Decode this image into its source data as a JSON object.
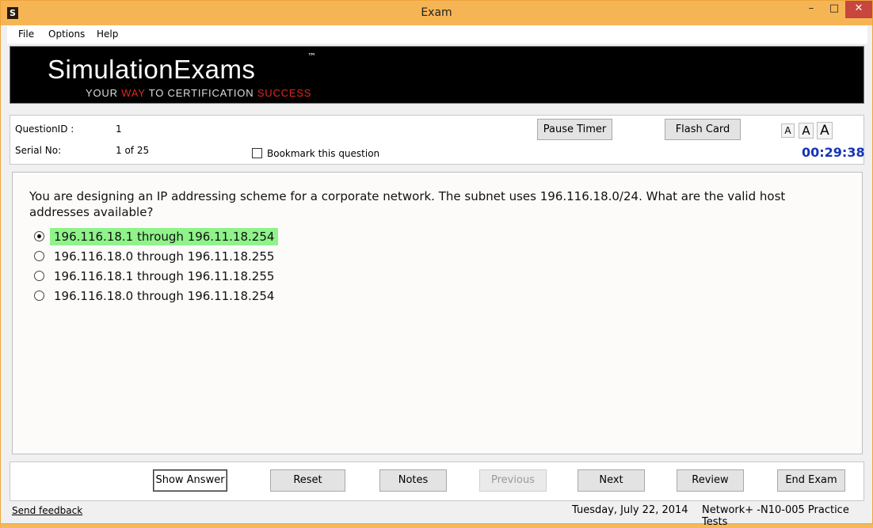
{
  "window": {
    "title": "Exam",
    "app_icon": "S",
    "minimize": "–",
    "maximize": "□",
    "close": "✕"
  },
  "menu": [
    "File",
    "Options",
    "Help"
  ],
  "banner": {
    "logo": "SimulationExams",
    "tm": "™",
    "tagline": [
      "YOUR ",
      "WAY",
      " TO CERTIFICATION ",
      "SUCCESS"
    ],
    "accent_color": "#e0281f"
  },
  "info": {
    "question_id_label": "QuestionID :",
    "question_id_value": "1",
    "serial_label": "Serial No:",
    "serial_value": "1 of 25",
    "bookmark_label": "Bookmark this question",
    "pause_timer": "Pause Timer",
    "flash_card": "Flash Card",
    "font_buttons": [
      "A",
      "A",
      "A"
    ],
    "timer": "00:29:38"
  },
  "question": {
    "text": "You are designing an IP addressing scheme for a corporate network. The subnet uses 196.116.18.0/24. What are the valid host addresses available?",
    "options": [
      {
        "text": "196.116.18.1 through 196.11.18.254",
        "selected": true,
        "correct": true
      },
      {
        "text": "196.116.18.0 through 196.11.18.255",
        "selected": false,
        "correct": false
      },
      {
        "text": "196.116.18.1 through 196.11.18.255",
        "selected": false,
        "correct": false
      },
      {
        "text": "196.116.18.0 through 196.11.18.254",
        "selected": false,
        "correct": false
      }
    ],
    "correct_highlight_color": "#8ff38a"
  },
  "buttons": {
    "show_answer": "Show Answer",
    "reset": "Reset",
    "notes": "Notes",
    "previous": "Previous",
    "next": "Next",
    "review": "Review",
    "end_exam": "End Exam"
  },
  "footer": {
    "feedback": "Send feedback",
    "date": "Tuesday, July 22, 2014",
    "product": "Network+ -N10-005 Practice Tests"
  },
  "colors": {
    "titlebar": "#f6b554",
    "timer": "#1534b8",
    "close": "#c7463d"
  }
}
